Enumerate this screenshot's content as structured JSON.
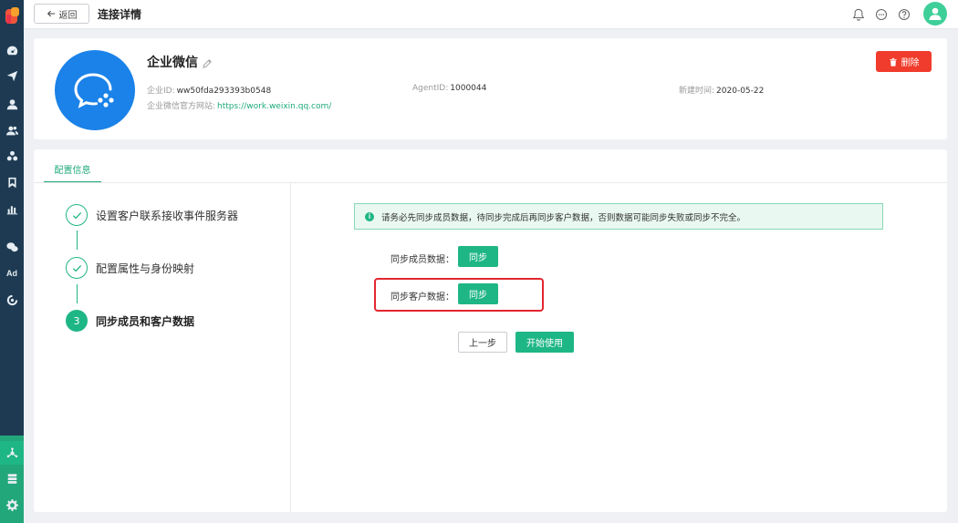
{
  "header": {
    "back_label": "返回",
    "title": "连接详情"
  },
  "enterprise": {
    "name": "企业微信",
    "corp_id_label": "企业ID:",
    "corp_id": "ww50fda293393b0548",
    "agent_id_label": "AgentID:",
    "agent_id": "1000044",
    "created_label": "新建时间:",
    "created": "2020-05-22",
    "site_label": "企业微信官方网站:",
    "site": "https://work.weixin.qq.com/",
    "delete_label": "删除"
  },
  "config": {
    "tab_label": "配置信息",
    "steps": [
      {
        "label": "设置客户联系接收事件服务器",
        "status": "done"
      },
      {
        "label": "配置属性与身份映射",
        "status": "done"
      },
      {
        "number": "3",
        "label": "同步成员和客户数据",
        "status": "active"
      }
    ],
    "alert": "请务必先同步成员数据，待同步完成后再同步客户数据，否则数据可能同步失败或同步不完全。",
    "sync_members_label": "同步成员数据：",
    "sync_customers_label": "同步客户数据：",
    "sync_button": "同步",
    "prev_button": "上一步",
    "start_button": "开始使用"
  },
  "sidebar": {
    "items": [
      "dashboard-icon",
      "send-icon",
      "user-icon",
      "users-icon",
      "group-icon",
      "bookmark-icon",
      "chart-icon",
      "wechat-icon",
      "ad-icon",
      "target-icon"
    ],
    "ad_label": "Ad",
    "bottom_items": [
      "connect-icon",
      "database-icon",
      "gear-icon"
    ]
  },
  "colors": {
    "sidebar": "#1d3a52",
    "accent": "#1fb685",
    "danger": "#f03c2c",
    "logo_blue": "#1a82e8"
  }
}
